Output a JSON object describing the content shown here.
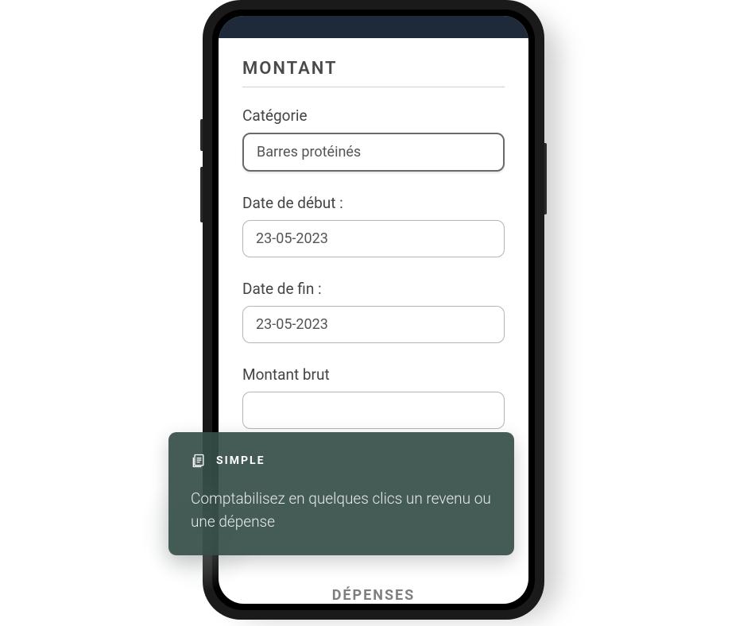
{
  "form": {
    "section_title": "MONTANT",
    "fields": {
      "category": {
        "label": "Catégorie",
        "value": "Barres protéinés"
      },
      "date_start": {
        "label": "Date de début :",
        "value": "23-05-2023"
      },
      "date_end": {
        "label": "Date de fin :",
        "value": "23-05-2023"
      },
      "gross_amount": {
        "label": "Montant brut",
        "value": ""
      }
    }
  },
  "bottom_tab": {
    "label": "DÉPENSES"
  },
  "overlay": {
    "badge": "SIMPLE",
    "body": "Comptabilisez en quelques clics un revenu ou une dépense"
  }
}
